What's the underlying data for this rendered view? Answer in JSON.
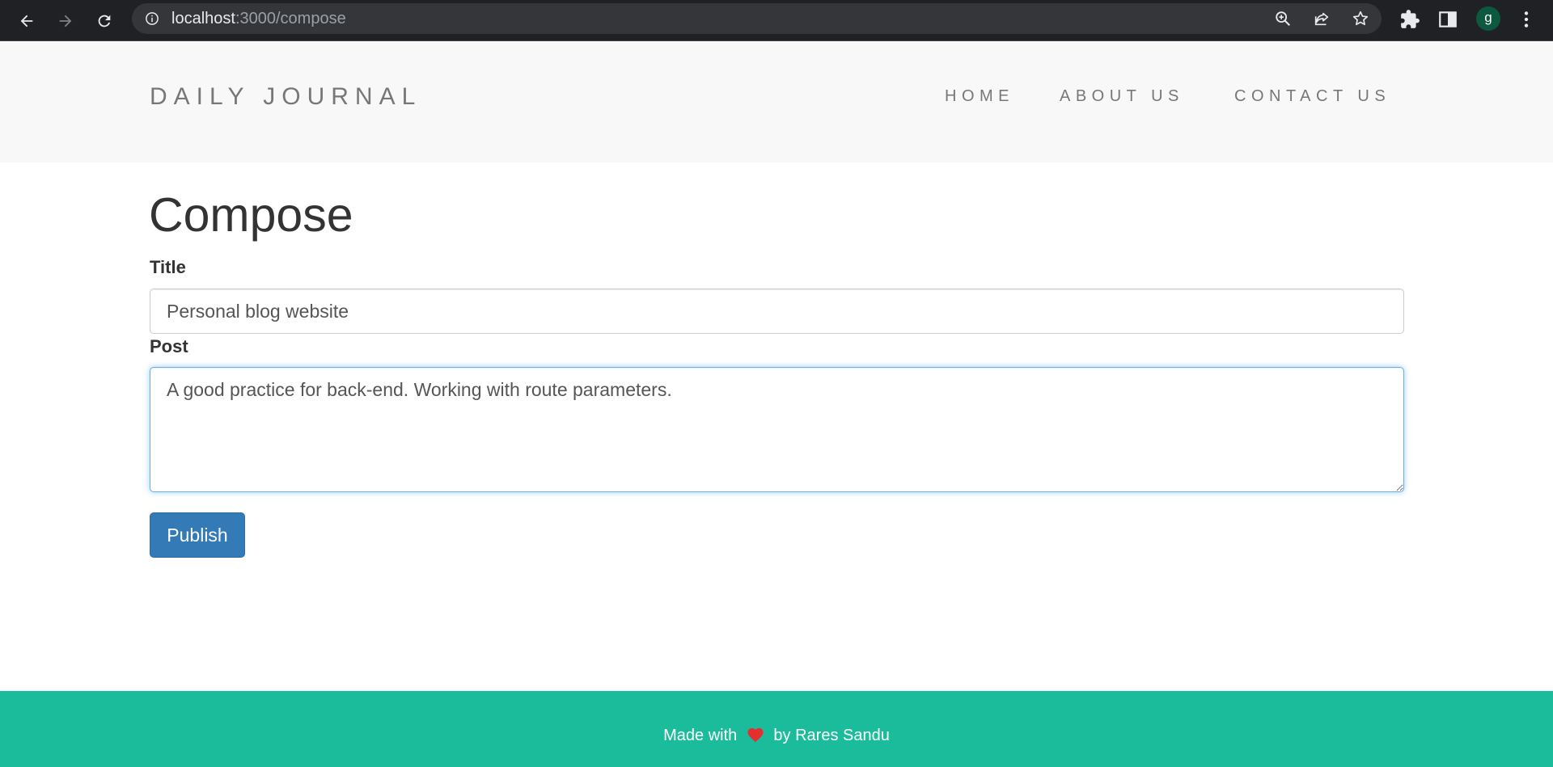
{
  "browser": {
    "url_host": "localhost",
    "url_path": ":3000/compose",
    "profile_initial": "g",
    "icons": [
      "back-arrow-icon",
      "forward-arrow-icon",
      "reload-icon",
      "info-icon",
      "zoom-icon",
      "share-icon",
      "star-icon",
      "puzzle-icon",
      "side-panel-icon",
      "kebab-menu-icon"
    ]
  },
  "header": {
    "brand": "DAILY JOURNAL",
    "nav": [
      {
        "label": "HOME"
      },
      {
        "label": "ABOUT US"
      },
      {
        "label": "CONTACT US"
      }
    ]
  },
  "main": {
    "title": "Compose",
    "title_label": "Title",
    "title_value": "Personal blog website",
    "post_label": "Post",
    "post_value": "A good practice for back-end. Working with route parameters.",
    "publish_label": "Publish"
  },
  "footer": {
    "prefix": "Made with",
    "suffix": "by Rares Sandu",
    "heart_icon": "heart-icon"
  },
  "colors": {
    "browser_bar": "#202124",
    "header_bg": "#f8f8f8",
    "primary_button": "#337ab7",
    "footer_bg": "#1abc9c",
    "heart": "#e52e2e"
  }
}
